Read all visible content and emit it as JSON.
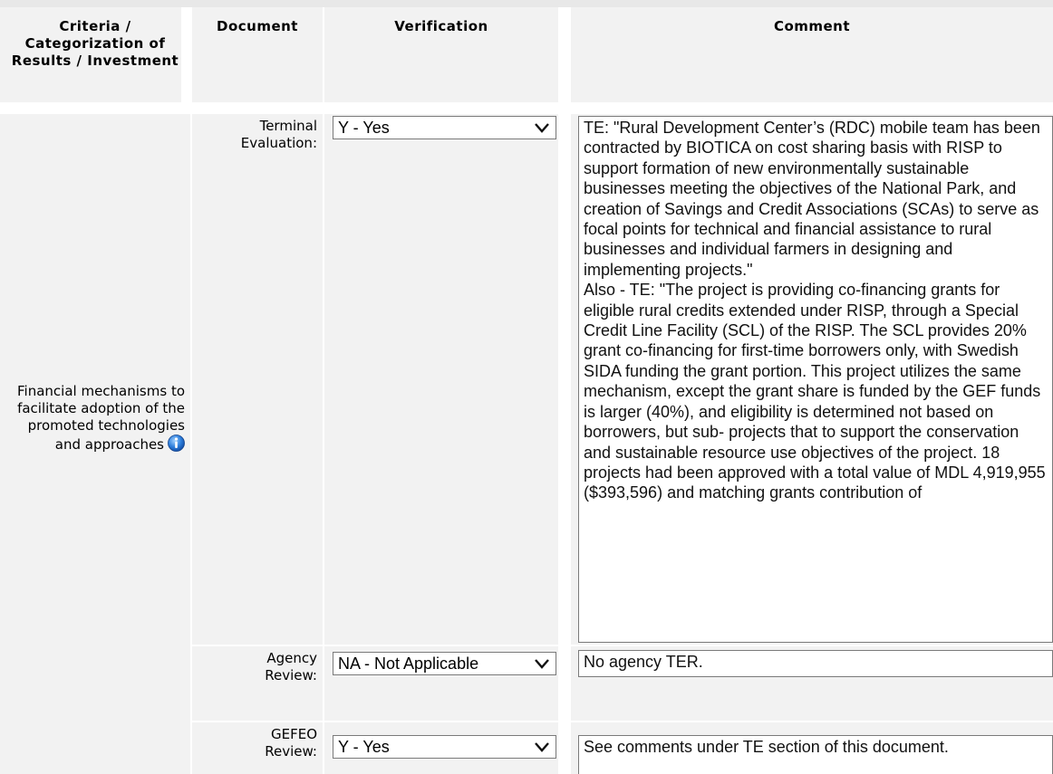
{
  "table": {
    "headers": {
      "criteria": "Criteria / Categorization of Results / Investment",
      "document": "Document",
      "verification": "Verification",
      "comment": "Comment"
    },
    "criteria_label": "Financial mechanisms to facilitate adoption of the promoted technologies and approaches",
    "rows": [
      {
        "document": "Terminal Evaluation:",
        "verification": "Y - Yes",
        "comment": "TE: \"Rural Development Center’s (RDC) mobile team has been contracted by BIOTICA on cost sharing basis with RISP to support formation of new environmentally sustainable businesses meeting the objectives of the National Park, and creation of Savings and Credit Associations (SCAs) to serve as focal points for technical and financial assistance to rural businesses and individual farmers in designing and implementing projects.\"\nAlso - TE: \"The project is providing co-financing grants for eligible rural credits extended under RISP, through a Special Credit Line Facility (SCL) of the RISP. The SCL provides 20% grant co-financing for first-time borrowers only, with Swedish SIDA funding the grant portion. This project utilizes the same mechanism, except the grant share is funded by the GEF funds is larger (40%), and eligibility is determined not based on borrowers, but sub- projects that to support the conservation and sustainable resource use objectives of the project. 18 projects had been approved with a total value of MDL 4,919,955 ($393,596) and matching grants contribution of"
      },
      {
        "document": "Agency Review:",
        "verification": "NA - Not Applicable",
        "comment": "No agency TER."
      },
      {
        "document": "GEFEO Review:",
        "verification": "Y - Yes",
        "comment": "See comments under TE section of this document."
      }
    ]
  },
  "icons": {
    "info": "info-icon",
    "dropdown": "chevron-down-icon"
  },
  "colors": {
    "cell_bg": "#f2f2f2",
    "border": "#7a7a7a",
    "info_blue": "#1f6fd0"
  }
}
